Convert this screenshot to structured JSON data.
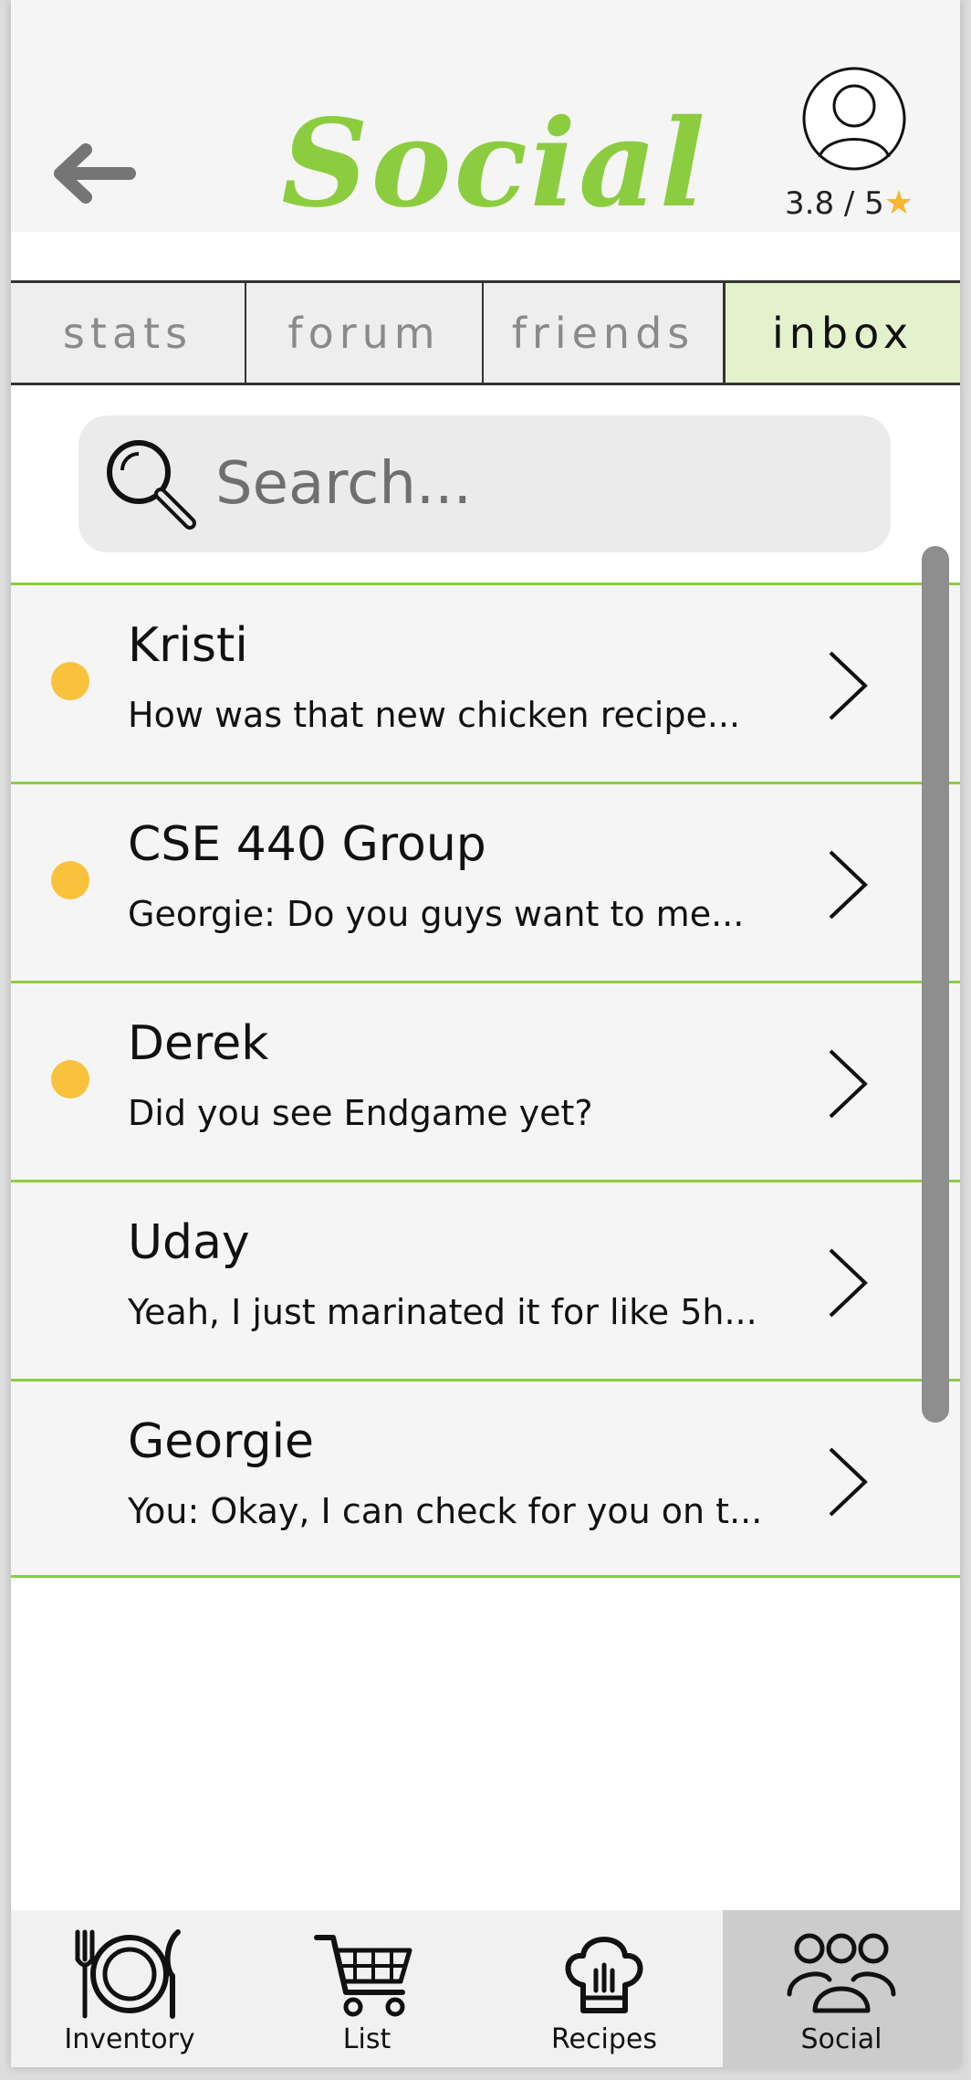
{
  "header": {
    "title": "Social",
    "rating": "3.8 / 5",
    "rating_star": "★"
  },
  "tabs": [
    {
      "label": "stats",
      "active": false
    },
    {
      "label": "forum",
      "active": false
    },
    {
      "label": "friends",
      "active": false
    },
    {
      "label": "inbox",
      "active": true
    }
  ],
  "search": {
    "placeholder": "Search..."
  },
  "conversations": [
    {
      "name": "Kristi",
      "preview": "How was that new chicken recipe...",
      "unread": true
    },
    {
      "name": "CSE 440 Group",
      "preview": "Georgie: Do you guys want to me...",
      "unread": true
    },
    {
      "name": "Derek",
      "preview": "Did you see Endgame yet?",
      "unread": true
    },
    {
      "name": "Uday",
      "preview": "Yeah, I just marinated it for like 5h...",
      "unread": false
    },
    {
      "name": "Georgie",
      "preview": "You: Okay, I can check for you on t...",
      "unread": false
    }
  ],
  "bottom_nav": [
    {
      "label": "Inventory",
      "icon": "plate-utensils-icon",
      "active": false
    },
    {
      "label": "List",
      "icon": "shopping-cart-icon",
      "active": false
    },
    {
      "label": "Recipes",
      "icon": "chef-hat-icon",
      "active": false
    },
    {
      "label": "Social",
      "icon": "people-group-icon",
      "active": true
    }
  ],
  "colors": {
    "accent_green": "#8ccd3f",
    "unread_dot": "#f9c23c",
    "star": "#f6b632",
    "active_tab_bg": "#e3f1cc",
    "active_nav_bg": "#cccccc"
  }
}
